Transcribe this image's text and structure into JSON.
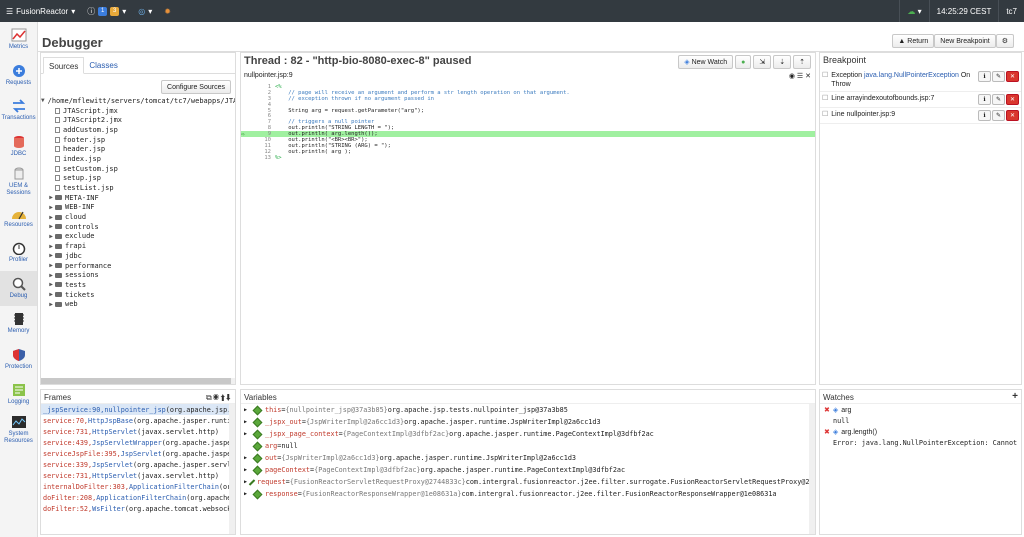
{
  "topbar": {
    "brand": "FusionReactor",
    "badge1": "1",
    "badge2": "3",
    "clock": "14:25:29 CEST",
    "instance": "tc7"
  },
  "nav": [
    {
      "label": "Metrics",
      "icon": "chart-icon"
    },
    {
      "label": "Requests",
      "icon": "requests-icon"
    },
    {
      "label": "Transactions",
      "icon": "transactions-icon"
    },
    {
      "label": "JDBC",
      "icon": "database-icon"
    },
    {
      "label": "UEM & Sessions",
      "icon": "uem-icon"
    },
    {
      "label": "Resources",
      "icon": "resources-icon"
    },
    {
      "label": "Profiler",
      "icon": "stopwatch-icon"
    },
    {
      "label": "Debug",
      "icon": "debug-icon"
    },
    {
      "label": "Memory",
      "icon": "memory-icon"
    },
    {
      "label": "Protection",
      "icon": "shield-icon"
    },
    {
      "label": "Logging",
      "icon": "logging-icon"
    },
    {
      "label": "System Resources",
      "icon": "system-icon"
    }
  ],
  "header": {
    "title": "Debugger",
    "return_label": "Return",
    "new_breakpoint_label": "New Breakpoint"
  },
  "sources": {
    "tab_sources": "Sources",
    "tab_classes": "Classes",
    "configure_label": "Configure Sources",
    "root": "/home/mflewitt/servers/tomcat/tc7/webapps/JTA",
    "files": [
      "JTAScript.jmx",
      "JTAScript2.jmx",
      "addCustom.jsp",
      "footer.jsp",
      "header.jsp",
      "index.jsp",
      "setCustom.jsp",
      "setup.jsp",
      "testList.jsp"
    ],
    "folders": [
      "META-INF",
      "WEB-INF",
      "cloud",
      "controls",
      "exclude",
      "frapi",
      "jdbc",
      "performance",
      "sessions",
      "tests",
      "tickets",
      "web"
    ]
  },
  "thread": {
    "title": "Thread : 82 - \"http-bio-8080-exec-8\" paused",
    "new_watch_label": "New Watch",
    "file": "nullpointer.jsp:9",
    "code": [
      {
        "n": "1",
        "t": "<%",
        "c": "kw"
      },
      {
        "n": "2",
        "t": "    // page will receive an argument and perform a str length operation on that argument.",
        "c": "cm"
      },
      {
        "n": "3",
        "t": "    // exception thrown if no argument passed in",
        "c": "cm"
      },
      {
        "n": "4",
        "t": "",
        "c": ""
      },
      {
        "n": "5",
        "t": "    String arg = request.getParameter(\"arg\");",
        "c": ""
      },
      {
        "n": "6",
        "t": "",
        "c": ""
      },
      {
        "n": "7",
        "t": "    // triggers a null pointer",
        "c": "cm"
      },
      {
        "n": "8",
        "t": "    out.println(\"STRING LENGTH = \");",
        "c": ""
      },
      {
        "n": "9",
        "t": "    out.println( arg.length());",
        "c": "",
        "hl": true
      },
      {
        "n": "10",
        "t": "    out.println(\"<BR><BR>\");",
        "c": ""
      },
      {
        "n": "11",
        "t": "    out.println(\"STRING (ARG) = \");",
        "c": ""
      },
      {
        "n": "12",
        "t": "    out.println( arg );",
        "c": ""
      },
      {
        "n": "13",
        "t": "%>",
        "c": "kw"
      }
    ]
  },
  "breakpoints": {
    "title": "Breakpoint",
    "items": [
      {
        "prefix": "Exception ",
        "link": "java.lang.NullPointerException",
        "suffix": " On Throw"
      },
      {
        "prefix": "Line arrayindexoutofbounds.jsp:7",
        "link": "",
        "suffix": ""
      },
      {
        "prefix": "Line nullpointer.jsp:9",
        "link": "",
        "suffix": ""
      }
    ]
  },
  "frames": {
    "title": "Frames",
    "rows": [
      {
        "loc": "_jspService:90,",
        "cls": "nullpointer_jsp",
        "pkg": " (org.apache.jsp."
      },
      {
        "loc": "service:70,",
        "cls": "HttpJspBase",
        "pkg": " (org.apache.jasper.runti"
      },
      {
        "loc": "service:731,",
        "cls": "HttpServlet",
        "pkg": " (javax.servlet.http)"
      },
      {
        "loc": "service:439,",
        "cls": "JspServletWrapper",
        "pkg": " (org.apache.jaspe"
      },
      {
        "loc": "serviceJspFile:395,",
        "cls": "JspServlet",
        "pkg": " (org.apache.jaspe"
      },
      {
        "loc": "service:339,",
        "cls": "JspServlet",
        "pkg": " (org.apache.jasper.servle"
      },
      {
        "loc": "service:731,",
        "cls": "HttpServlet",
        "pkg": " (javax.servlet.http)"
      },
      {
        "loc": "internalDoFilter:303,",
        "cls": "ApplicationFilterChain",
        "pkg": " (or"
      },
      {
        "loc": "doFilter:208,",
        "cls": "ApplicationFilterChain",
        "pkg": " (org.apache"
      },
      {
        "loc": "doFilter:52,",
        "cls": "WsFilter",
        "pkg": " (org.apache.tomcat.websock"
      }
    ]
  },
  "variables": {
    "title": "Variables",
    "rows": [
      {
        "name": "this",
        "meta": "{nullpointer_jsp@37a3b85}",
        "val": "org.apache.jsp.tests.nullpointer_jsp@37a3b85",
        "exp": true
      },
      {
        "name": "_jspx_out",
        "meta": "{JspWriterImpl@2a6cc1d3}",
        "val": "org.apache.jasper.runtime.JspWriterImpl@2a6cc1d3",
        "exp": true
      },
      {
        "name": "_jspx_page_context",
        "meta": "{PageContextImpl@3dfbf2ac}",
        "val": "org.apache.jasper.runtime.PageContextImpl@3dfbf2ac",
        "exp": true
      },
      {
        "name": "arg",
        "meta": "",
        "val": "null",
        "exp": false
      },
      {
        "name": "out",
        "meta": "{JspWriterImpl@2a6cc1d3}",
        "val": "org.apache.jasper.runtime.JspWriterImpl@2a6cc1d3",
        "exp": true
      },
      {
        "name": "pageContext",
        "meta": "{PageContextImpl@3dfbf2ac}",
        "val": "org.apache.jasper.runtime.PageContextImpl@3dfbf2ac",
        "exp": true
      },
      {
        "name": "request",
        "meta": "{FusionReactorServletRequestProxy@2744833c}",
        "val": "com.intergral.fusionreactor.j2ee.filter.surrogate.FusionReactorServletRequestProxy@274483",
        "exp": true
      },
      {
        "name": "response",
        "meta": "{FusionReactorResponseWrapper@1e08631a}",
        "val": "com.intergral.fusionreactor.j2ee.filter.FusionReactorResponseWrapper@1e08631a",
        "exp": true
      }
    ]
  },
  "watches": {
    "title": "Watches",
    "items": [
      {
        "expr": "arg",
        "val": "null"
      },
      {
        "expr": "arg.length()",
        "val": "Error: java.lang.NullPointerException: Cannot i"
      }
    ]
  },
  "colors": {
    "accent": "#2a5db0",
    "topbar": "#333a40",
    "highlight": "#a0f0a0",
    "danger": "#d9362e"
  }
}
